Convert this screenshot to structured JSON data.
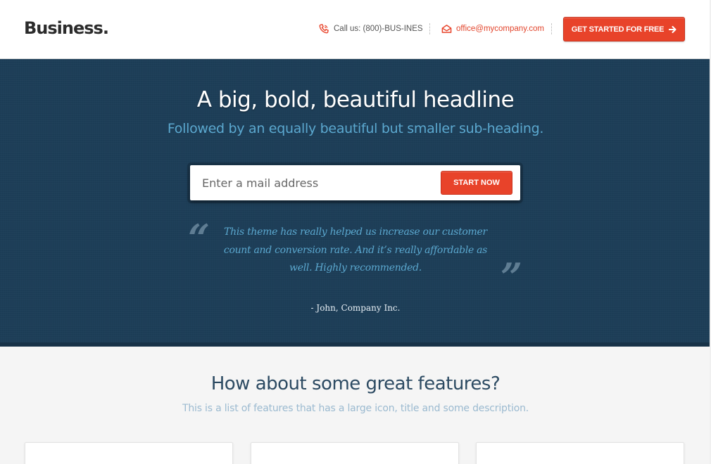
{
  "header": {
    "logo": "Business.",
    "phone_label": "Call us: (800)-BUS-INES",
    "email_label": "office@mycompany.com",
    "cta_label": "GET STARTED FOR FREE",
    "icons": {
      "phone": "phone-icon",
      "email": "envelope-icon",
      "cta": "arrow-right-icon"
    }
  },
  "hero": {
    "title": "A big, bold, beautiful headline",
    "subtitle": "Followed by an equally beautiful but smaller sub-heading.",
    "email_placeholder": "Enter a mail address",
    "start_label": "START NOW",
    "quote_open": "“",
    "quote_close": "”",
    "quote": "This theme has really helped us increase our customer count and conversion rate. And it’s really affordable as well. Highly recommended.",
    "author": "- John, Company Inc."
  },
  "features": {
    "title": "How about some great features?",
    "subtitle": "This is a list of features that has a large icon, title and some description."
  },
  "colors": {
    "accent": "#e8432a",
    "hero_bg": "#1d3e58",
    "hero_sub": "#5ba8cf",
    "features_title": "#2c4a62"
  }
}
